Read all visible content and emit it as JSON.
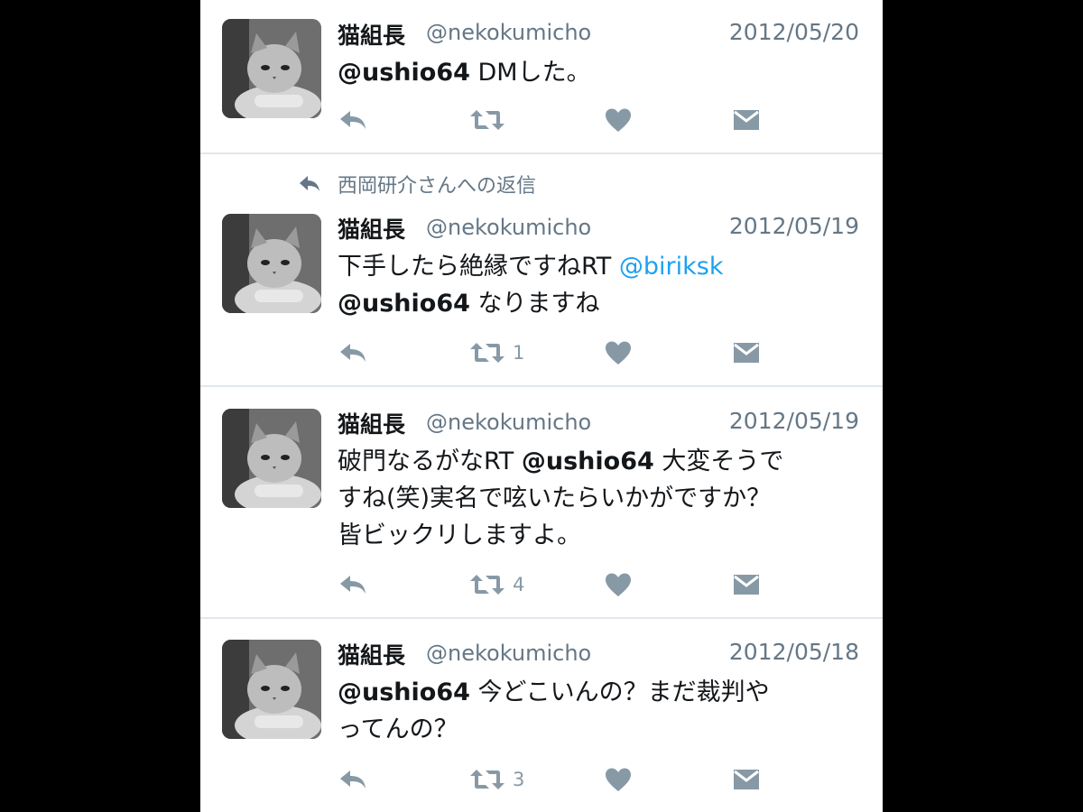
{
  "colors": {
    "link": "#1da1f2",
    "secondary_text": "#657786",
    "action_icon": "#8899a6",
    "divider": "#e1e8ed"
  },
  "reply_context": "西岡研介さんへの返信",
  "tweets": [
    {
      "name": "猫組長",
      "handle": "@nekokumicho",
      "date": "2012/05/20",
      "lines": [
        [
          {
            "t": "@ushio64",
            "k": "mention"
          },
          {
            "t": " DMした。",
            "k": "plain"
          }
        ]
      ],
      "retweet_count": ""
    },
    {
      "name": "猫組長",
      "handle": "@nekokumicho",
      "date": "2012/05/19",
      "lines": [
        [
          {
            "t": "下手したら絶縁ですねRT ",
            "k": "plain"
          },
          {
            "t": "@biriksk",
            "k": "link"
          }
        ],
        [
          {
            "t": "@ushio64",
            "k": "mention"
          },
          {
            "t": " なりますね",
            "k": "plain"
          }
        ]
      ],
      "retweet_count": "1"
    },
    {
      "name": "猫組長",
      "handle": "@nekokumicho",
      "date": "2012/05/19",
      "lines": [
        [
          {
            "t": "破門なるがなRT ",
            "k": "plain"
          },
          {
            "t": "@ushio64",
            "k": "mention"
          },
          {
            "t": " 大変そうで",
            "k": "plain"
          }
        ],
        [
          {
            "t": "すね(笑)実名で呟いたらいかがですか？",
            "k": "plain"
          }
        ],
        [
          {
            "t": "皆ビックリしますよ。",
            "k": "plain"
          }
        ]
      ],
      "retweet_count": "4"
    },
    {
      "name": "猫組長",
      "handle": "@nekokumicho",
      "date": "2012/05/18",
      "lines": [
        [
          {
            "t": "@ushio64",
            "k": "mention"
          },
          {
            "t": " 今どこいんの？まだ裁判や",
            "k": "plain"
          }
        ],
        [
          {
            "t": "ってんの？",
            "k": "plain"
          }
        ]
      ],
      "retweet_count": "3"
    }
  ],
  "icons": {
    "reply": "reply-icon",
    "retweet": "retweet-icon",
    "like": "heart-icon",
    "dm": "envelope-icon"
  }
}
